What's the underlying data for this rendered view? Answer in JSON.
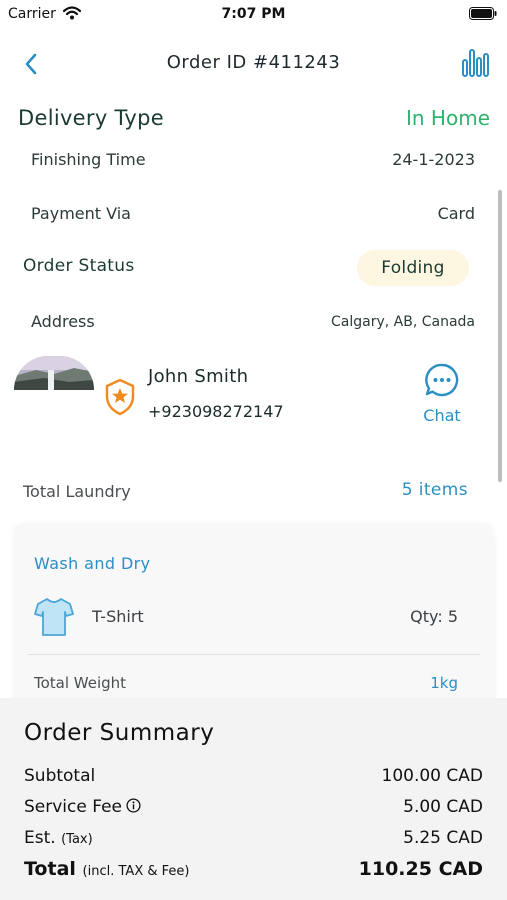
{
  "status_bar": {
    "carrier": "Carrier",
    "time": "7:07 PM"
  },
  "header": {
    "title": "Order ID #411243"
  },
  "delivery": {
    "label": "Delivery Type",
    "value": "In Home"
  },
  "details": {
    "finishing_label": "Finishing Time",
    "finishing_value": "24-1-2023",
    "payment_label": "Payment Via",
    "payment_value": "Card",
    "status_label": "Order Status",
    "status_value": "Folding",
    "address_label": "Address",
    "address_value": "Calgary, AB, Canada"
  },
  "person": {
    "name": "John Smith",
    "phone": "+923098272147",
    "chat_label": "Chat"
  },
  "laundry": {
    "label": "Total Laundry",
    "count": "5 items"
  },
  "wash_card": {
    "title": "Wash and Dry",
    "item_name": "T-Shirt",
    "item_qty": "Qty: 5",
    "weight_label": "Total Weight",
    "weight_value": "1kg"
  },
  "summary": {
    "title": "Order Summary",
    "subtotal_label": "Subtotal",
    "subtotal_value": "100.00 CAD",
    "service_label": "Service Fee",
    "service_value": "5.00 CAD",
    "tax_label": "Est.",
    "tax_note": "(Tax)",
    "tax_value": "5.25 CAD",
    "total_label": "Total",
    "total_note": "(incl. TAX & Fee)",
    "total_value": "110.25 CAD"
  },
  "colors": {
    "accent_blue": "#2b8fc4",
    "in_home_green": "#2fb36d",
    "status_pill_bg": "#fdf6e0",
    "badge_orange": "#f08a1c"
  },
  "icons": {
    "back": "chevron-left-icon",
    "chart": "bar-chart-icon",
    "wifi": "wifi-icon",
    "battery": "battery-icon",
    "badge": "shield-star-icon",
    "chat": "chat-bubble-icon",
    "tshirt": "tshirt-icon",
    "info": "info-icon"
  }
}
